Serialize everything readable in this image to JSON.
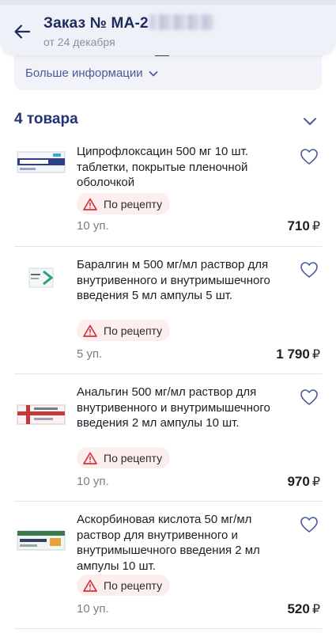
{
  "header": {
    "title": "Заказ № МА-2",
    "subtitle": "от 24 декабря"
  },
  "info": {
    "more_label": "Больше информации"
  },
  "section": {
    "title": "4 товара"
  },
  "products": [
    {
      "name": "Ципрофлоксацин 500 мг 10 шт. таблетки, покрытые пленочной оболочкой",
      "badge": "По рецепту",
      "qty": "10 уп.",
      "price": "710",
      "currency": "₽"
    },
    {
      "name": "Баралгин м 500 мг/мл раствор для внутривенного и внутримышечного введения 5 мл ампулы 5 шт.",
      "badge": "По рецепту",
      "qty": "5 уп.",
      "price": "1 790",
      "currency": "₽"
    },
    {
      "name": "Анальгин 500 мг/мл раствор для внутривенного и внутримышечного введения 2 мл ампулы 10 шт.",
      "badge": "По рецепту",
      "qty": "10 уп.",
      "price": "970",
      "currency": "₽"
    },
    {
      "name": "Аскорбиновая кислота 50 мг/мл раствор для внутривенного и внутримышечного введения 2 мл ампулы 10 шт.",
      "badge": "По рецепту",
      "qty": "10 уп.",
      "price": "520",
      "currency": "₽"
    }
  ],
  "colors": {
    "accent": "#253374",
    "badge_bg": "#fdeeee",
    "warning": "#d6303c"
  },
  "icons": {
    "back": "arrow-left-icon",
    "more": "chevron-down-icon",
    "collapse": "chevron-down-icon",
    "favorite": "heart-outline-icon",
    "rx": "warning-triangle-icon"
  }
}
